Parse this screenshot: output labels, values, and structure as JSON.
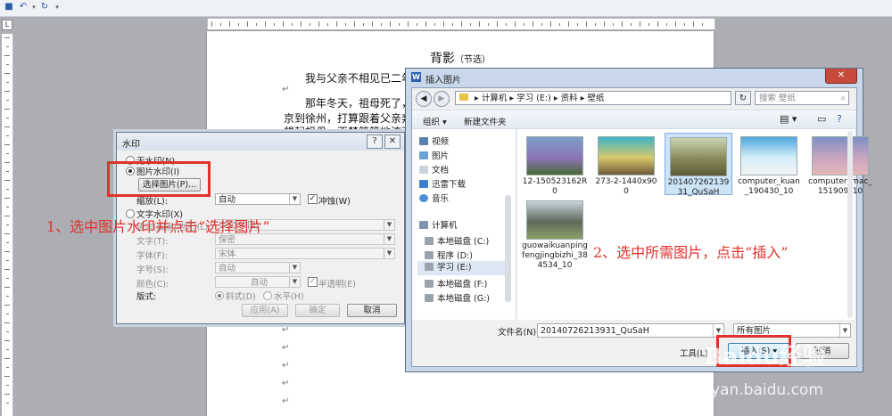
{
  "document": {
    "title": "背影",
    "subtitle": "（节选）",
    "lines": [
      "我与父亲不相见已二年",
      "那年冬天，祖母死了，",
      "京到徐州，打算跟着父亲奔",
      "想起祖母，不禁簌簌地流下"
    ]
  },
  "watermark_dialog": {
    "title": "水印",
    "help_label": "?",
    "close_label": "✕",
    "no_watermark": "无水印(N)",
    "picture_watermark": "图片水印(I)",
    "select_picture_button": "选择图片(P)...",
    "scale_label": "缩放(L):",
    "scale_value": "自动",
    "washout_label": "冲蚀(W)",
    "text_watermark": "文字水印(X)",
    "language_label": "语言(国家/地区)(L):",
    "language_value": "中文(中国)",
    "text_label": "文字(T):",
    "text_value": "保密",
    "font_label": "字体(F):",
    "font_value": "宋体",
    "size_label": "字号(S):",
    "size_value": "自动",
    "color_label": "颜色(C):",
    "color_value": "自动",
    "semitransparent_label": "半透明(E)",
    "layout_label": "版式:",
    "diagonal_label": "斜式(D)",
    "horizontal_label": "水平(H)",
    "apply_button": "应用(A)",
    "ok_button": "确定",
    "cancel_button": "取消"
  },
  "insert_dialog": {
    "title": "插入图片",
    "close_label": "✕",
    "breadcrumb": [
      "计算机",
      "学习 (E:)",
      "资料",
      "壁纸"
    ],
    "search_placeholder": "搜索 壁纸",
    "organize_label": "组织 ▾",
    "new_folder_label": "新建文件夹",
    "nav_items": [
      {
        "label": "视频",
        "icon": "video-icon"
      },
      {
        "label": "图片",
        "icon": "pictures-icon"
      },
      {
        "label": "文档",
        "icon": "documents-icon"
      },
      {
        "label": "迅雷下载",
        "icon": "download-icon"
      },
      {
        "label": "音乐",
        "icon": "music-icon"
      }
    ],
    "computer_label": "计算机",
    "drives": [
      "本地磁盘 (C:)",
      "程序 (D:)",
      "学习 (E:)",
      "本地磁盘 (F:)",
      "本地磁盘 (G:)"
    ],
    "selected_drive": "学习 (E:)",
    "files": [
      {
        "name": "12-150523162R0",
        "colors": [
          "#7d9ec8",
          "#8e74b8",
          "#4a6b3a"
        ]
      },
      {
        "name": "273-2-1440x900",
        "colors": [
          "#3fb3c5",
          "#d8c96b",
          "#6e5a3a"
        ]
      },
      {
        "name": "20140726213931_QuSaH",
        "colors": [
          "#c9d6b4",
          "#8a8a58",
          "#5a5a3a"
        ]
      },
      {
        "name": "computer_kuan_190430_10",
        "colors": [
          "#4ea6de",
          "#d6eef8",
          "#f2f4f6"
        ]
      },
      {
        "name": "computer_mac_151909_10",
        "colors": [
          "#7e8fc4",
          "#c8a4c0",
          "#e6b8b8"
        ]
      },
      {
        "name": "guowaikuanpingfengjingbizhi_384534_10",
        "colors": [
          "#c9d4dc",
          "#5e6a5a",
          "#8aa06a"
        ]
      }
    ],
    "filename_label": "文件名(N):",
    "filename_value": "20140726213931_QuSaH",
    "filetype_value": "所有图片",
    "tools_label": "工具(L)",
    "insert_button": "插入(S)",
    "cancel_button": "取消"
  },
  "annotations": {
    "step1": "1、选中图片水印并点击“选择图片”",
    "step2": "2、选中所需图片，点击“插入”"
  },
  "watermark_site": "jingyan.baidu.com",
  "watermark_brand": "Baidu经验",
  "colors": {
    "annotation_red": "#e0312c",
    "selection_blue": "#cde4f7"
  }
}
